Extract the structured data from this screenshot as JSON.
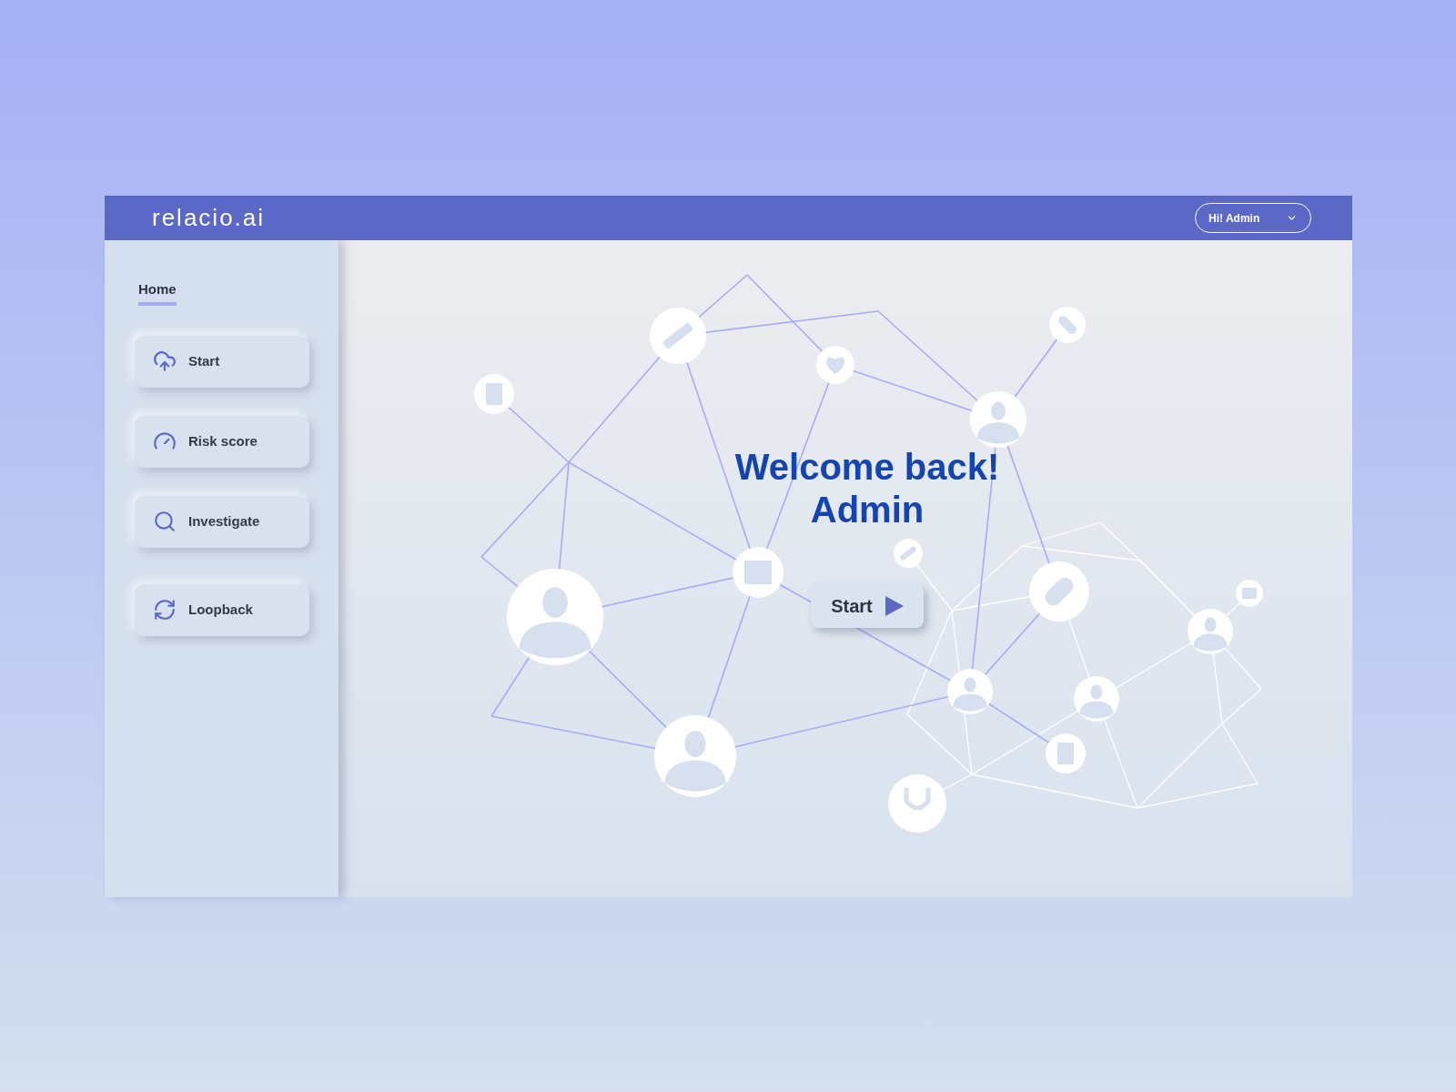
{
  "header": {
    "logo": "relacio.ai",
    "user_menu": "Hi! Admin"
  },
  "sidebar": {
    "tab": {
      "label": "Home",
      "selected": true
    },
    "items": [
      {
        "label": "Start"
      },
      {
        "label": "Risk score"
      },
      {
        "label": "Investigate"
      },
      {
        "label": "Loopback"
      }
    ]
  },
  "main": {
    "welcome_line_1": "Welcome back!",
    "welcome_line_2": "Admin",
    "start_button": "Start"
  }
}
